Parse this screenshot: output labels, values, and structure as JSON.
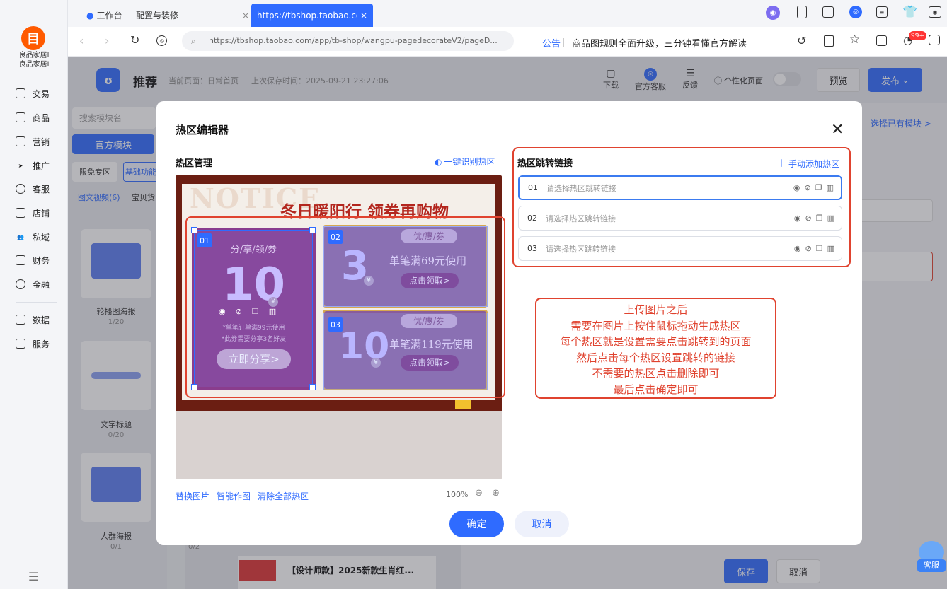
{
  "browser": {
    "tabs": [
      {
        "label": "工作台"
      },
      {
        "label": "配置与装修"
      },
      {
        "label": "https://tbshop.taobao.com..."
      }
    ],
    "url": "https://tbshop.taobao.com/app/tb-shop/wangpu-pagedecorateV2/pageD...",
    "announcement_label": "公告",
    "announcement_text": "商品图规则全面升级，三分钟看懂官方解读",
    "notification_badge": "99+"
  },
  "sidebar": {
    "shop_name": "良品家居l\n良品家居l",
    "items": [
      {
        "label": "交易",
        "icon": "trade-icon"
      },
      {
        "label": "商品",
        "icon": "goods-icon"
      },
      {
        "label": "营销",
        "icon": "marketing-icon"
      },
      {
        "label": "推广",
        "icon": "promote-icon"
      },
      {
        "label": "客服",
        "icon": "service-icon"
      },
      {
        "label": "店铺",
        "icon": "shop-icon"
      },
      {
        "label": "私域",
        "icon": "private-icon"
      },
      {
        "label": "财务",
        "icon": "finance-icon"
      },
      {
        "label": "金融",
        "icon": "money-icon"
      },
      {
        "label": "数据",
        "icon": "data-icon"
      },
      {
        "label": "服务",
        "icon": "services-icon"
      }
    ]
  },
  "page_header": {
    "title": "推荐",
    "current_page": "当前页面：日常首页",
    "last_saved": "上次保存时间：2025-09-21 23:27:06",
    "download": "下载",
    "official_service": "官方客服",
    "feedback": "反馈",
    "personalize": "个性化页面",
    "preview": "预览",
    "publish": "发布"
  },
  "left_panel": {
    "search_placeholder": "搜索模块名",
    "official_module": "官方模块",
    "tag_free": "限免专区",
    "tag_basic": "基础功能",
    "filter_video": "图文视频(6)",
    "filter_goods": "宝贝货",
    "modules": [
      {
        "label": "轮播图海报",
        "count": "1/20"
      },
      {
        "label": "文字标题",
        "count": "0/20"
      },
      {
        "label": "人群海报",
        "count": "0/1"
      }
    ],
    "extra_count": "0/2"
  },
  "right_panel": {
    "choose_existing": "选择已有模块 >",
    "product_title": "【设计师款】2025新款生肖红...",
    "save": "保存",
    "cancel": "取消",
    "customer_service": "客服"
  },
  "modal": {
    "title": "热区编辑器",
    "hotspot_manage": "热区管理",
    "auto_detect": "一键识别热区",
    "jump_links": "热区跳转链接",
    "add_manual": "手动添加热区",
    "rows": [
      {
        "num": "01",
        "placeholder": "请选择热区跳转链接"
      },
      {
        "num": "02",
        "placeholder": "请选择热区跳转链接"
      },
      {
        "num": "03",
        "placeholder": "请选择热区跳转链接"
      }
    ],
    "replace_image": "替换图片",
    "smart_image": "智能作图",
    "clear_all": "清除全部热区",
    "zoom": "100%",
    "confirm": "确定",
    "cancel": "取消",
    "instructions": [
      "上传图片之后",
      "需要在图片上按住鼠标拖动生成热区",
      "每个热区就是设置需要点击跳转到的页面",
      "然后点击每个热区设置跳转的链接",
      "不需要的热区点击删除即可",
      "最后点击确定即可"
    ]
  },
  "banner": {
    "notice": "NOTICE",
    "headline": "冬日暖阳行 领券再购物",
    "coupon1": {
      "tag": "01",
      "title": "分/享/领/券",
      "amount": "10",
      "unit": "¥",
      "note1": "*单笔订单满99元使用",
      "note2": "*此券需要分享3名好友",
      "cta": "立即分享>"
    },
    "coupon2": {
      "tag": "02",
      "title": "优/惠/券",
      "amount": "3",
      "unit": "¥",
      "cond": "单笔满69元使用",
      "cta": "点击领取>"
    },
    "coupon3": {
      "tag": "03",
      "title": "优/惠/券",
      "amount": "10",
      "unit": "¥",
      "cond": "单笔满119元使用",
      "cta": "点击领取>"
    }
  },
  "colors": {
    "accent": "#2f6bff",
    "annotation_red": "#e0432f",
    "banner_dark": "#6b1e12",
    "coupon_purple": "#8a3d8d"
  }
}
